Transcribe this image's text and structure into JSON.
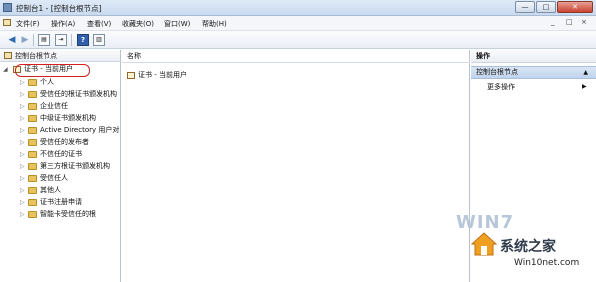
{
  "window": {
    "title": "控制台1 - [控制台根节点]",
    "buttons": {
      "minimize": "—",
      "maximize": "□",
      "close": "✕"
    }
  },
  "menu": [
    "文件(F)",
    "操作(A)",
    "查看(V)",
    "收藏夹(O)",
    "窗口(W)",
    "帮助(H)"
  ],
  "mdi_buttons": [
    "_",
    "□",
    "×"
  ],
  "toolbar": {
    "icons": [
      "back-arrow-icon",
      "forward-arrow-icon",
      "show-hide-tree-icon",
      "export-list-icon",
      "help-icon",
      "action-pane-icon"
    ]
  },
  "tree": {
    "header": "控制台根节点",
    "root": "证书 - 当前用户",
    "children": [
      "个人",
      "受信任的根证书颁发机构",
      "企业信任",
      "中级证书颁发机构",
      "Active Directory 用户对",
      "受信任的发布者",
      "不信任的证书",
      "第三方根证书颁发机构",
      "受信任人",
      "其他人",
      "证书注册申请",
      "智能卡受信任的根"
    ]
  },
  "list": {
    "column": "名称",
    "items": [
      "证书 - 当前用户"
    ]
  },
  "actions": {
    "title": "操作",
    "group": "控制台根节点",
    "items": [
      "更多操作"
    ]
  },
  "watermark": {
    "win_text": "WIN7",
    "brand": "系统之家",
    "url": "Win10net.com"
  }
}
